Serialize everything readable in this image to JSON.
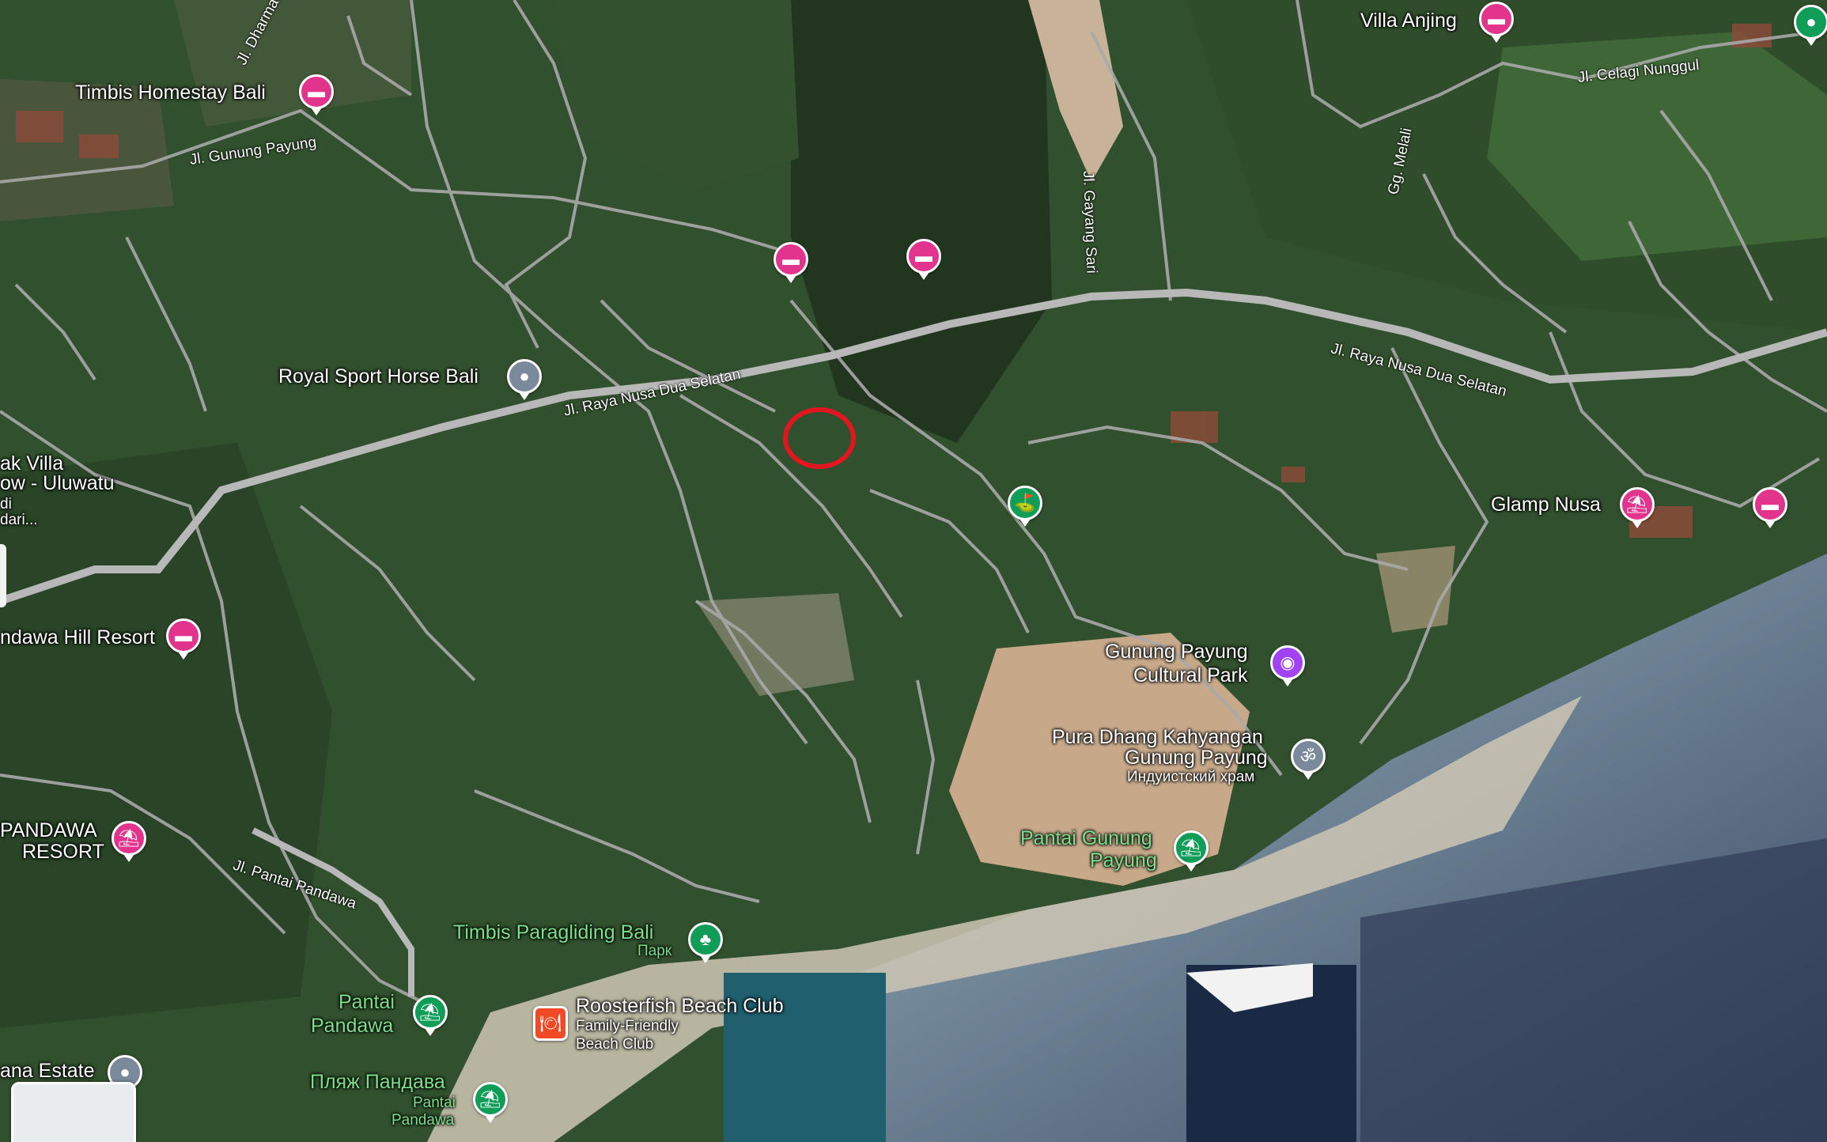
{
  "map": {
    "colors": {
      "pin_hotel": "#e2348c",
      "pin_nature": "#0f9d58",
      "pin_place": "#7b8a9a",
      "pin_culture": "#a142f4",
      "pin_food": "#f24a24",
      "marker": "#e3161f"
    },
    "labels": {
      "villa_anjing": "Villa Anjing",
      "timbis_homestay": "Timbis Homestay Bali",
      "royal_sport": "Royal Sport Horse Bali",
      "ak_villa_l1": "ak Villa",
      "ak_villa_l2": "ow - Uluwatu",
      "ak_villa_l3": "di",
      "ak_villa_l4": "dari...",
      "ndawa_hill": "ndawa Hill Resort",
      "pandawa_resort_l1": "PANDAWA",
      "pandawa_resort_l2": "RESORT",
      "glamp_nusa": "Glamp Nusa",
      "gunung_payung_cp_l1": "Gunung Payung",
      "gunung_payung_cp_l2": "Cultural Park",
      "pura_l1": "Pura Dhang Kahyangan",
      "pura_l2": "Gunung Payung",
      "pura_sub": "Индуистский храм",
      "pantai_gp_l1": "Pantai Gunung",
      "pantai_gp_l2": "Payung",
      "timbis_para": "Timbis Paragliding Bali",
      "timbis_para_sub": "Парк",
      "rooster": "Roosterfish Beach Club",
      "rooster_sub1": "Family-Friendly",
      "rooster_sub2": "Beach Club",
      "pantai_pandawa_l1": "Pantai",
      "pantai_pandawa_l2": "Pandawa",
      "plyazh": "Пляж Пандава",
      "plyazh_sub1": "Pantai",
      "plyazh_sub2": "Pandawa",
      "ana_estate": "ana Estate"
    },
    "roads": {
      "dharma": "Jl. Dharma",
      "gunung_payung": "Jl. Gunung Payung",
      "celagi": "Jl. Celagi Nunggul",
      "melali": "Gg. Melali",
      "gayang": "Jl. Gayang Sari",
      "raya_left": "Jl. Raya Nusa Dua Selatan",
      "raya_right": "Jl. Raya Nusa Dua Selatan",
      "pantai_pandawa": "Jl. Pantai Pandawa"
    },
    "pin_glyphs": {
      "hotel": "▬",
      "nature": "♣",
      "place": "●",
      "camera": "◉",
      "temple": "ॐ",
      "beach": "⛱",
      "golf": "⛳",
      "food": "🍽"
    }
  }
}
